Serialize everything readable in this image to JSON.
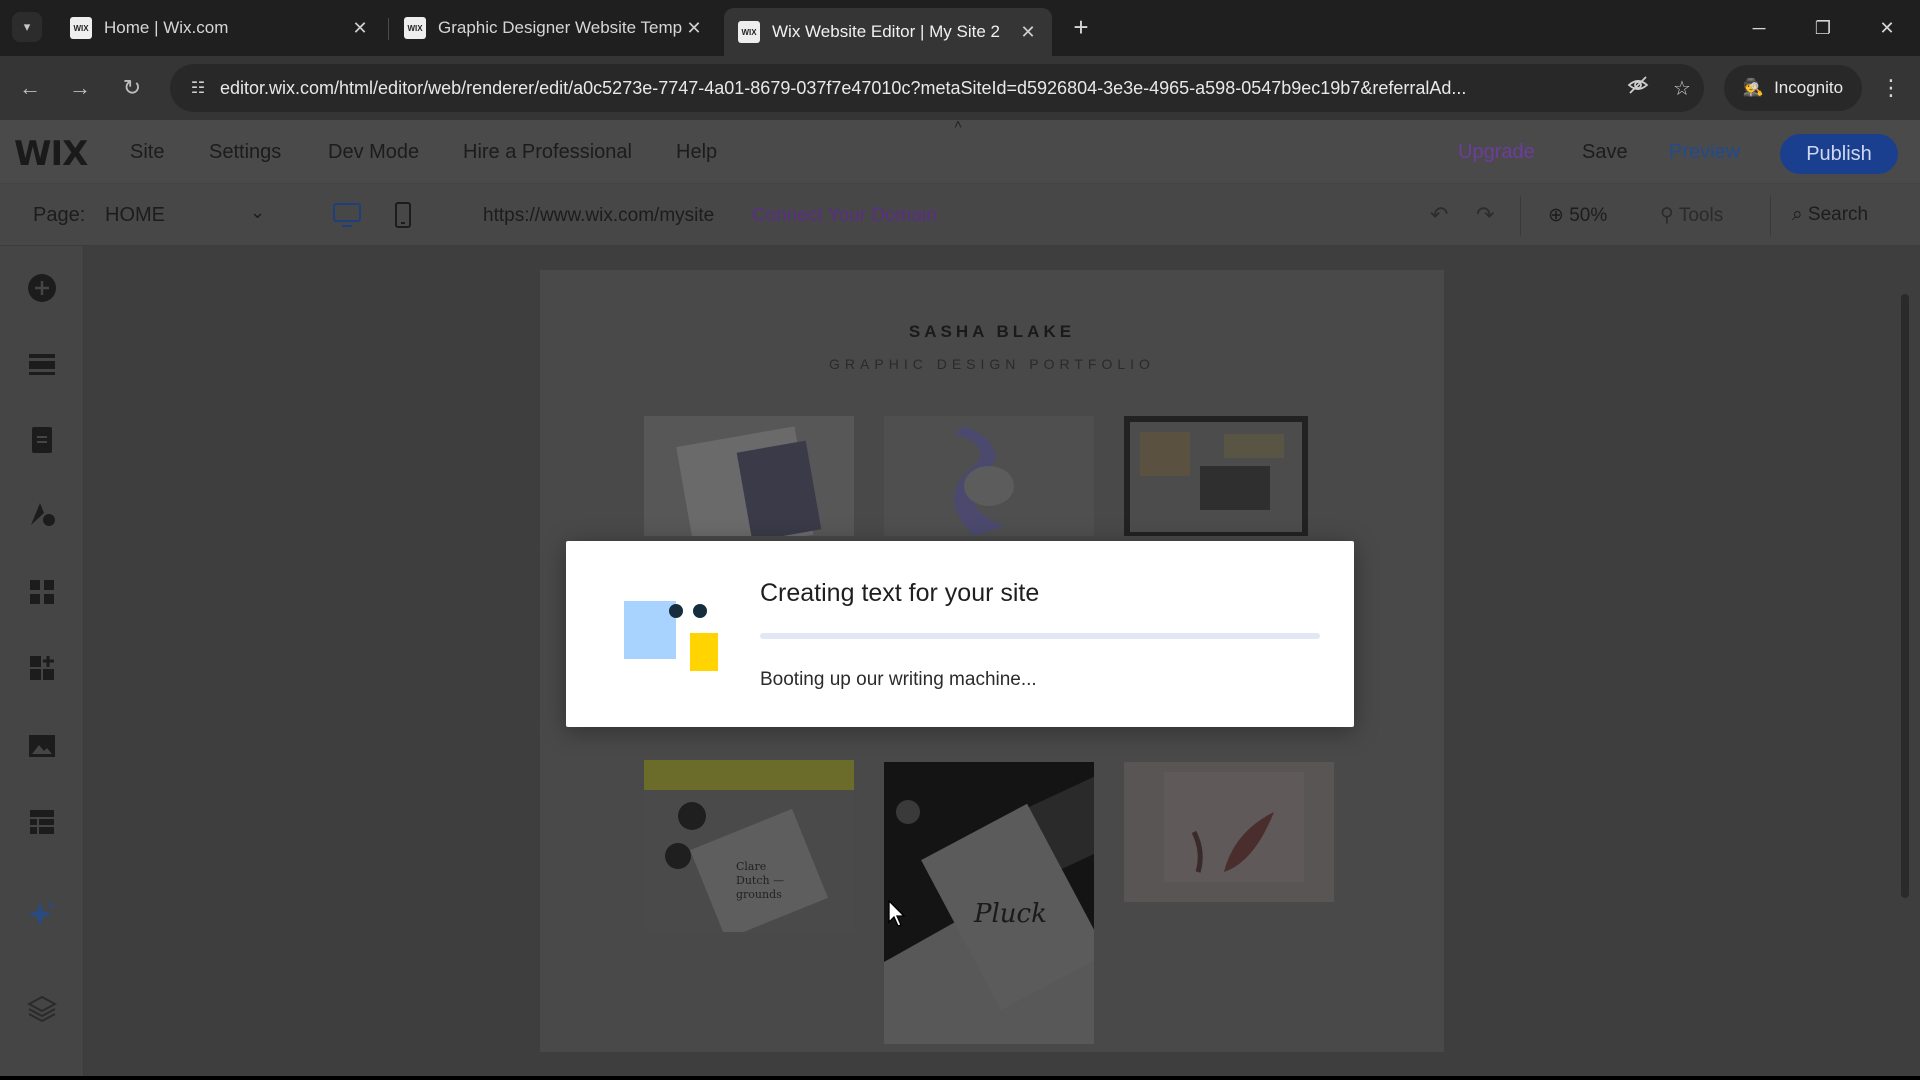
{
  "browser": {
    "tabs": [
      {
        "title": "Home | Wix.com",
        "active": false
      },
      {
        "title": "Graphic Designer Website Temp",
        "active": false
      },
      {
        "title": "Wix Website Editor | My Site 2",
        "active": true
      }
    ],
    "favicon_text": "WIX",
    "url": "editor.wix.com/html/editor/web/renderer/edit/a0c5273e-7747-4a01-8679-037f7e47010c?metaSiteId=d5926804-3e3e-4965-a598-0547b9ec19b7&referralAd...",
    "incognito_label": "Incognito"
  },
  "editor": {
    "logo": "WIX",
    "menu": [
      "Site",
      "Settings",
      "Dev Mode",
      "Hire a Professional",
      "Help"
    ],
    "upgrade_label": "Upgrade",
    "save_label": "Save",
    "preview_label": "Preview",
    "publish_label": "Publish",
    "page_label": "Page:",
    "page_name": "HOME",
    "site_url": "https://www.wix.com/mysite",
    "connect_domain_label": "Connect Your Domain",
    "zoom_label": "50%",
    "tools_label": "Tools",
    "search_label": "Search",
    "left_icons": [
      "add-icon",
      "sections-icon",
      "pages-icon",
      "design-icon",
      "apps-icon",
      "business-apps-icon",
      "media-icon",
      "cms-icon",
      "ai-sparkle-icon",
      "layers-icon"
    ]
  },
  "site": {
    "name": "SASHA BLAKE",
    "subtitle": "GRAPHIC DESIGN PORTFOLIO"
  },
  "modal": {
    "title": "Creating text for your site",
    "status": "Booting up our writing machine...",
    "progress": 0.0
  },
  "colors": {
    "publish": "#116dff",
    "accent_purple": "#9a27d5",
    "illus_blue": "#a8d3ff",
    "illus_yellow": "#ffd400",
    "illus_dark": "#162d3d"
  }
}
